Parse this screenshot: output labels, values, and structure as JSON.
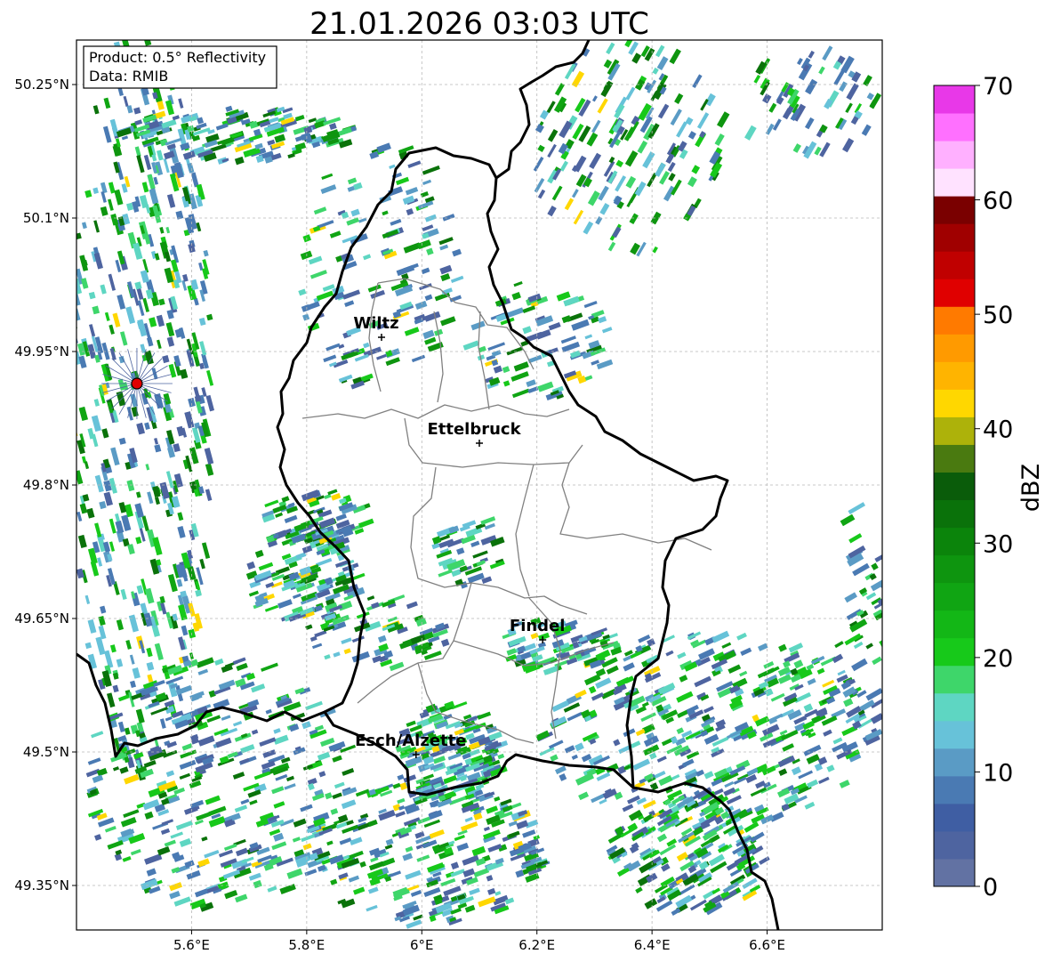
{
  "title": "21.01.2026 03:03 UTC",
  "info_box": {
    "product": "Product: 0.5° Reflectivity",
    "source": "Data: RMIB"
  },
  "map": {
    "lon_range": [
      5.4,
      6.8
    ],
    "lat_range": [
      49.3,
      50.3
    ],
    "x_ticks": [
      {
        "value": 5.6,
        "label": "5.6°E"
      },
      {
        "value": 5.8,
        "label": "5.8°E"
      },
      {
        "value": 6.0,
        "label": "6°E"
      },
      {
        "value": 6.2,
        "label": "6.2°E"
      },
      {
        "value": 6.4,
        "label": "6.4°E"
      },
      {
        "value": 6.6,
        "label": "6.6°E"
      }
    ],
    "y_ticks": [
      {
        "value": 50.25,
        "label": "50.25°N"
      },
      {
        "value": 50.1,
        "label": "50.1°N"
      },
      {
        "value": 49.95,
        "label": "49.95°N"
      },
      {
        "value": 49.8,
        "label": "49.8°N"
      },
      {
        "value": 49.65,
        "label": "49.65°N"
      },
      {
        "value": 49.5,
        "label": "49.5°N"
      },
      {
        "value": 49.35,
        "label": "49.35°N"
      }
    ],
    "cities": [
      {
        "name": "Wiltz",
        "lon": 5.93,
        "lat": 49.966
      },
      {
        "name": "Ettelbruck",
        "lon": 6.1,
        "lat": 49.847
      },
      {
        "name": "Findel",
        "lon": 6.21,
        "lat": 49.626
      },
      {
        "name": "Esch/Alzette",
        "lon": 5.99,
        "lat": 49.497
      }
    ],
    "radar_site": {
      "lon": 5.505,
      "lat": 49.914,
      "color": "#e00000"
    }
  },
  "colorbar": {
    "label": "dBZ",
    "range": [
      0,
      70
    ],
    "ticks": [
      "0",
      "10",
      "20",
      "30",
      "40",
      "50",
      "60",
      "70"
    ],
    "colors": [
      "#6272a3",
      "#4e64a0",
      "#3f5ea3",
      "#4a7ab3",
      "#5a9bc5",
      "#67c2d9",
      "#5ed6c2",
      "#3ed66a",
      "#17c91a",
      "#13b716",
      "#10a513",
      "#0e950f",
      "#0b840b",
      "#0a720a",
      "#0a5c0a",
      "#4a7a10",
      "#adb20a",
      "#ffd700",
      "#ffb400",
      "#ff9a00",
      "#ff7a00",
      "#e00000",
      "#c00000",
      "#a00000",
      "#7a0000",
      "#ffe2ff",
      "#ffb0ff",
      "#ff70ff",
      "#e838e8"
    ]
  }
}
